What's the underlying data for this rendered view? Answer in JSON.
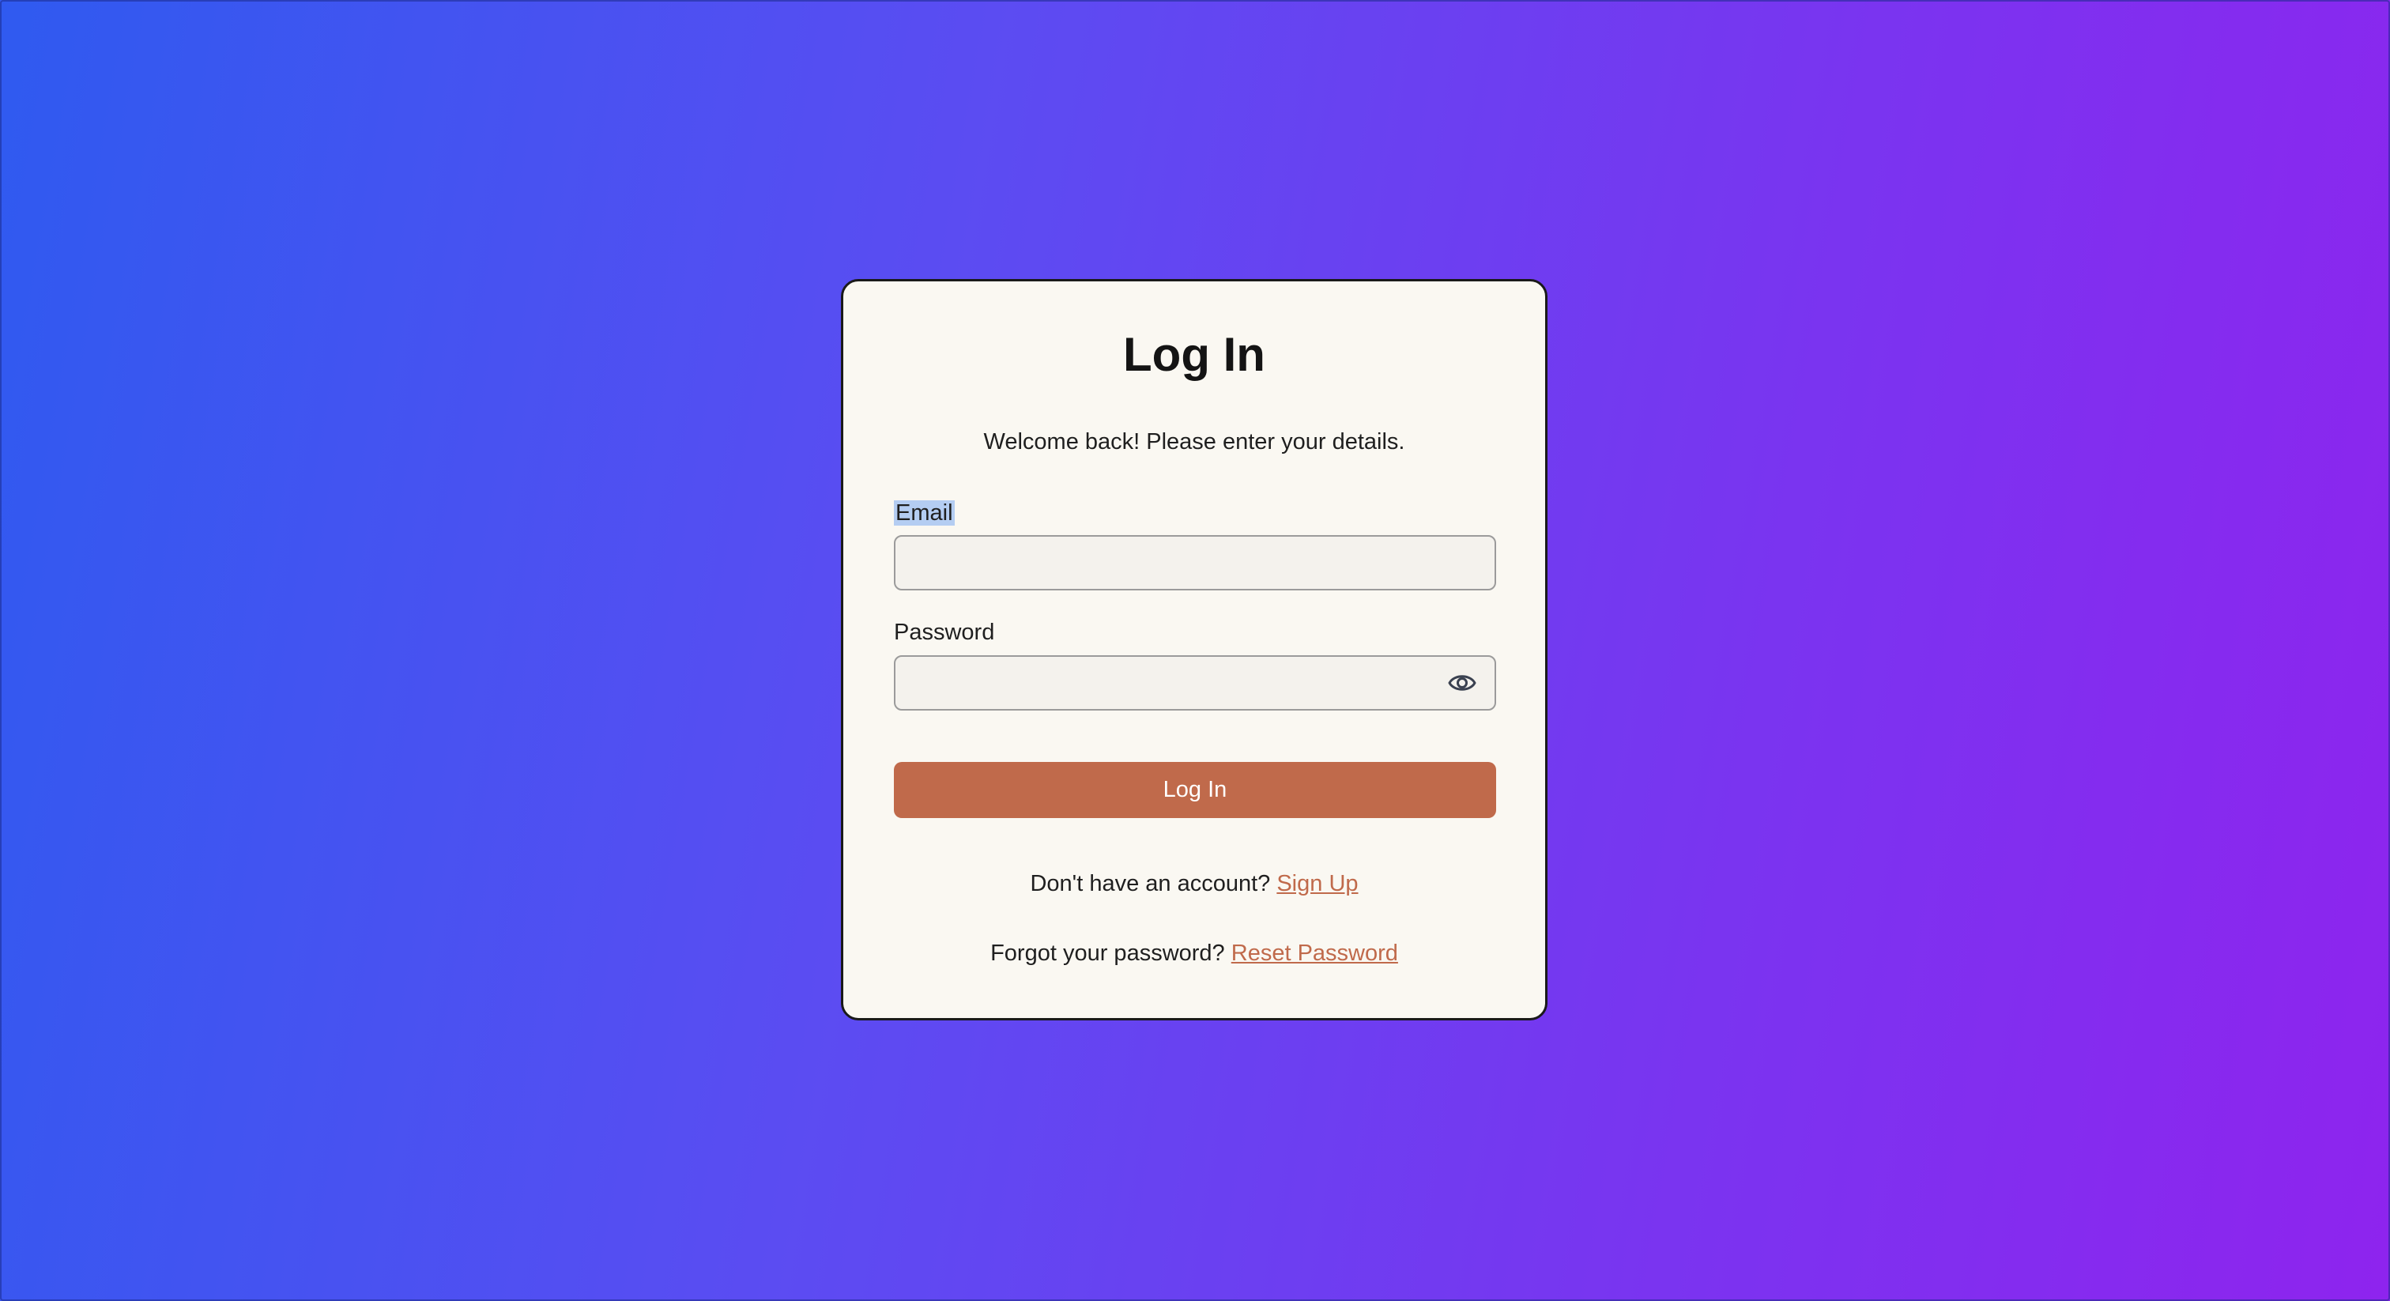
{
  "colors": {
    "background_start": "#2f5af0",
    "background_end": "#8e24ee",
    "card_background": "#faf8f2",
    "accent": "#c06a4b",
    "text": "#1f1f1f"
  },
  "login_card": {
    "title": "Log In",
    "subtitle": "Welcome back! Please enter your details.",
    "email": {
      "label": "Email",
      "value": "",
      "label_selected": true
    },
    "password": {
      "label": "Password",
      "value": "",
      "toggle_icon": "eye-icon"
    },
    "submit_label": "Log In",
    "signup": {
      "prompt": "Don't have an account?",
      "link": "Sign Up"
    },
    "reset": {
      "prompt": "Forgot your password?",
      "link": "Reset Password"
    }
  }
}
